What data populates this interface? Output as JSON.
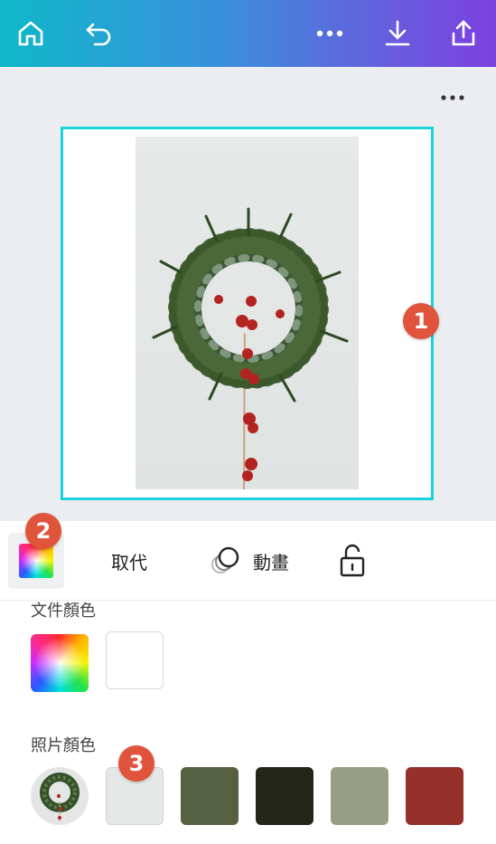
{
  "header": {
    "icons": [
      "home-icon",
      "undo-icon",
      "more-icon",
      "download-icon",
      "share-icon"
    ]
  },
  "canvas": {
    "selection_color": "#19d3db",
    "badges": [
      "1",
      "2",
      "3"
    ]
  },
  "toolbar": {
    "replace_label": "取代",
    "animate_label": "動畫"
  },
  "colors": {
    "document_title": "文件顏色",
    "document_swatches": [
      "gradient",
      "#ffffff"
    ],
    "photo_title": "照片顏色",
    "photo_swatches": [
      "#e6e8e7",
      "#556041",
      "#24261a",
      "#989e84",
      "#95302c"
    ]
  }
}
